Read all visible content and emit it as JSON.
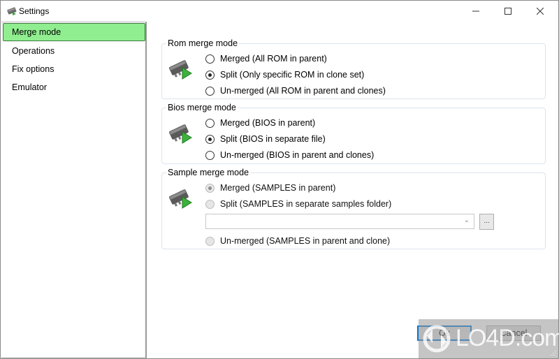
{
  "window": {
    "title": "Settings",
    "icon": "chip-settings-icon",
    "controls": {
      "minimize": "minimize-icon",
      "maximize": "maximize-icon",
      "close": "close-icon"
    }
  },
  "sidebar": {
    "items": [
      {
        "label": "Merge mode",
        "active": true
      },
      {
        "label": "Operations",
        "active": false
      },
      {
        "label": "Fix options",
        "active": false
      },
      {
        "label": "Emulator",
        "active": false
      }
    ],
    "active_color": "#90ee90"
  },
  "groups": {
    "rom": {
      "title": "Rom merge mode",
      "options": [
        {
          "label": "Merged (All ROM in parent)",
          "checked": false,
          "enabled": true
        },
        {
          "label": "Split (Only specific ROM in clone set)",
          "checked": true,
          "enabled": true
        },
        {
          "label": "Un-merged (All ROM in parent and clones)",
          "checked": false,
          "enabled": true
        }
      ]
    },
    "bios": {
      "title": "Bios merge mode",
      "options": [
        {
          "label": "Merged (BIOS in parent)",
          "checked": false,
          "enabled": true
        },
        {
          "label": "Split (BIOS in separate file)",
          "checked": true,
          "enabled": true
        },
        {
          "label": "Un-merged (BIOS in parent and clones)",
          "checked": false,
          "enabled": true
        }
      ]
    },
    "sample": {
      "title": "Sample merge mode",
      "options": [
        {
          "label": "Merged (SAMPLES in parent)",
          "checked": true,
          "enabled": false
        },
        {
          "label": "Split (SAMPLES in separate samples folder)",
          "checked": false,
          "enabled": false
        },
        {
          "label": "Un-merged (SAMPLES in parent and clone)",
          "checked": false,
          "enabled": false
        }
      ],
      "folder_combo": {
        "value": ""
      },
      "browse_label": "..."
    }
  },
  "buttons": {
    "ok": "Ok",
    "cancel": "Cancel"
  },
  "watermark": {
    "text": "LO4D.com"
  }
}
